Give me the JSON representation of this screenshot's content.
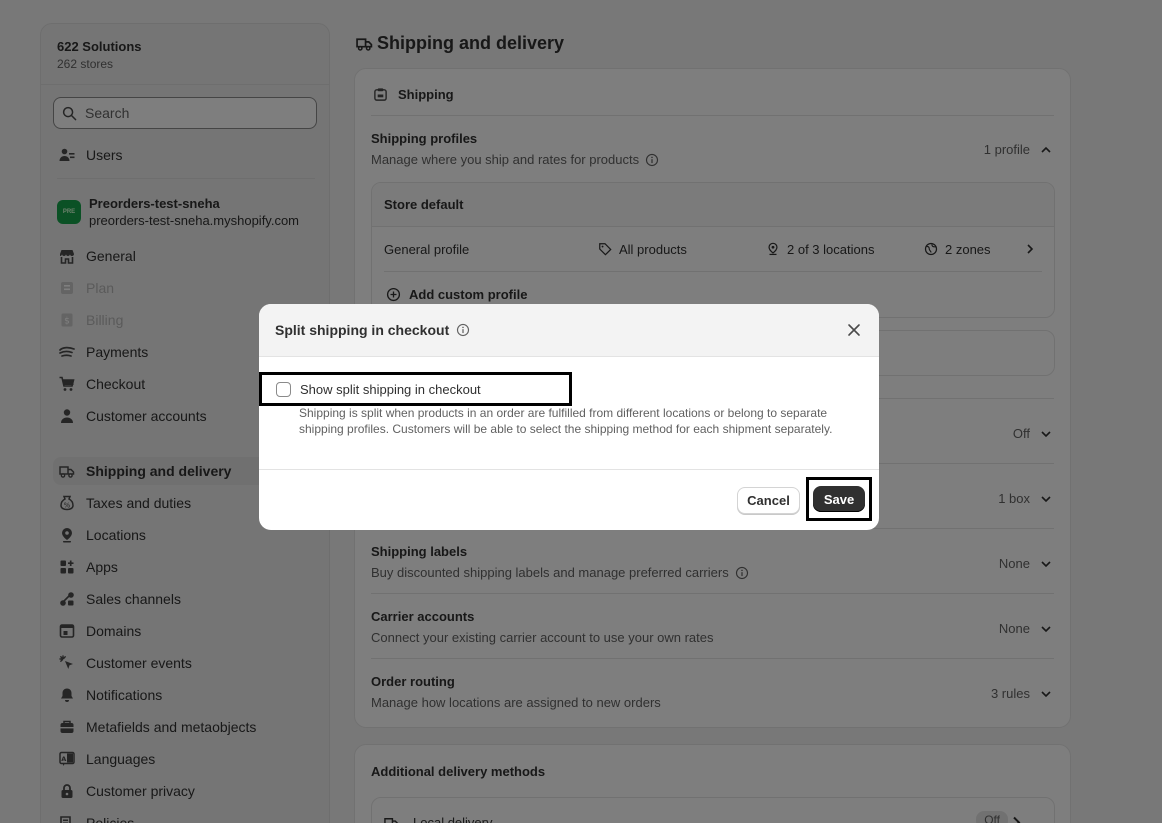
{
  "org": {
    "name": "622 Solutions",
    "stores": "262 stores"
  },
  "search": {
    "placeholder": "Search"
  },
  "users_label": "Users",
  "store": {
    "badge": "PRE",
    "name": "Preorders-test-sneha",
    "url": "preorders-test-sneha.myshopify.com"
  },
  "nav": [
    {
      "label": "General",
      "icon": "store-icon",
      "state": "normal"
    },
    {
      "label": "Plan",
      "icon": "plan-icon",
      "state": "disabled"
    },
    {
      "label": "Billing",
      "icon": "billing-icon",
      "state": "disabled"
    },
    {
      "label": "Payments",
      "icon": "payments-icon",
      "state": "normal"
    },
    {
      "label": "Checkout",
      "icon": "cart-icon",
      "state": "normal"
    },
    {
      "label": "Customer accounts",
      "icon": "person-icon",
      "state": "normal"
    },
    {
      "label": "Shipping and delivery",
      "icon": "truck-icon",
      "state": "active"
    },
    {
      "label": "Taxes and duties",
      "icon": "taxes-icon",
      "state": "normal"
    },
    {
      "label": "Locations",
      "icon": "location-pin-icon",
      "state": "normal"
    },
    {
      "label": "Apps",
      "icon": "apps-icon",
      "state": "normal"
    },
    {
      "label": "Sales channels",
      "icon": "sales-channels-icon",
      "state": "normal"
    },
    {
      "label": "Domains",
      "icon": "domains-icon",
      "state": "normal"
    },
    {
      "label": "Customer events",
      "icon": "cursor-icon",
      "state": "normal"
    },
    {
      "label": "Notifications",
      "icon": "bell-icon",
      "state": "normal"
    },
    {
      "label": "Metafields and metaobjects",
      "icon": "metafields-icon",
      "state": "normal"
    },
    {
      "label": "Languages",
      "icon": "languages-icon",
      "state": "normal"
    },
    {
      "label": "Customer privacy",
      "icon": "lock-icon",
      "state": "normal"
    },
    {
      "label": "Policies",
      "icon": "policies-icon",
      "state": "normal"
    }
  ],
  "page": {
    "title": "Shipping and delivery"
  },
  "shipping_card": {
    "title": "Shipping",
    "profiles": {
      "title": "Shipping profiles",
      "desc": "Manage where you ship and rates for products",
      "count": "1 profile",
      "store_default": "Store default",
      "general_profile": "General profile",
      "products": "All products",
      "locations": "2 of 3 locations",
      "zones": "2 zones",
      "add_custom": "Add custom profile"
    },
    "rows": [
      {
        "title": "",
        "desc": "",
        "value": "Off"
      },
      {
        "title": "",
        "desc": "",
        "value": "1 box"
      },
      {
        "title": "Shipping labels",
        "desc": "Buy discounted shipping labels and manage preferred carriers",
        "value": "None",
        "info": true
      },
      {
        "title": "Carrier accounts",
        "desc": "Connect your existing carrier account to use your own rates",
        "value": "None"
      },
      {
        "title": "Order routing",
        "desc": "Manage how locations are assigned to new orders",
        "value": "3 rules"
      }
    ]
  },
  "additional": {
    "title": "Additional delivery methods",
    "local_delivery": "Local delivery",
    "local_status": "Off"
  },
  "modal": {
    "title": "Split shipping in checkout",
    "checkbox_label": "Show split shipping in checkout",
    "help": "Shipping is split when products in an order are fulfilled from different locations or belong to separate shipping profiles. Customers will be able to select the shipping method for each shipment separately.",
    "cancel": "Cancel",
    "save": "Save"
  }
}
